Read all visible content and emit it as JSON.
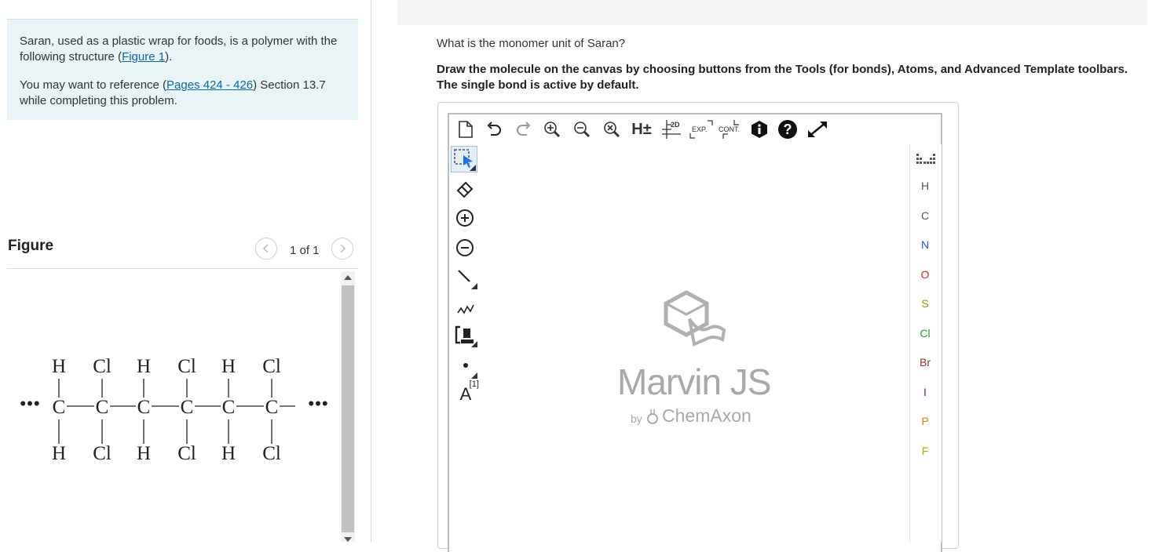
{
  "intro": {
    "p1_text": "Saran, used as a plastic wrap for foods, is a polymer with the following structure (",
    "p1_link": "Figure 1",
    "p1_end": ").",
    "p2_text": "You may want to reference (",
    "p2_link": "Pages 424 - 426",
    "p2_end": ") Section 13.7 while completing this problem."
  },
  "figure": {
    "title": "Figure",
    "count": "1 of 1",
    "structure": {
      "top_row": [
        "H",
        "Cl",
        "H",
        "Cl",
        "H",
        "Cl"
      ],
      "main_chain": [
        "C",
        "C",
        "C",
        "C",
        "C",
        "C"
      ],
      "bottom_row": [
        "H",
        "Cl",
        "H",
        "Cl",
        "H",
        "Cl"
      ],
      "left_end": "•••",
      "right_end": "•••"
    }
  },
  "question": {
    "prompt": "What is the monomer unit of Saran?",
    "instructions": "Draw the molecule on the canvas by choosing buttons from the Tools (for bonds), Atoms, and Advanced Template toolbars. The single bond is active by default."
  },
  "editor": {
    "top_tools": [
      "new-document-icon",
      "undo-icon",
      "redo-icon",
      "zoom-in-icon",
      "zoom-out-icon",
      "zoom-reset-icon",
      "add-hydrogens-icon",
      "clean-2d-icon",
      "expand-icon",
      "contract-icon",
      "info-icon",
      "help-icon",
      "fullscreen-icon"
    ],
    "hydrogen_label": "H±",
    "clean2d_label": "2D",
    "expand_label": "EXP.",
    "contract_label": "CONT.",
    "left_tools": [
      "select-icon",
      "eraser-icon",
      "plus-charge-icon",
      "minus-charge-icon",
      "single-bond-icon",
      "chain-icon",
      "bracket-icon",
      "radical-icon",
      "atom-map-icon"
    ],
    "atom_map_label": "A",
    "atom_map_sup": "[1]",
    "atoms": [
      {
        "symbol": "H",
        "color": "#555555"
      },
      {
        "symbol": "C",
        "color": "#555555"
      },
      {
        "symbol": "N",
        "color": "#3050f8"
      },
      {
        "symbol": "O",
        "color": "#e02020"
      },
      {
        "symbol": "S",
        "color": "#a09000"
      },
      {
        "symbol": "Cl",
        "color": "#1fa01f"
      },
      {
        "symbol": "Br",
        "color": "#a62929"
      },
      {
        "symbol": "I",
        "color": "#940094"
      },
      {
        "symbol": "P",
        "color": "#e08000"
      },
      {
        "symbol": "F",
        "color": "#b0a000"
      }
    ],
    "watermark_title": "Marvin JS",
    "watermark_by": "by",
    "watermark_brand": "ChemAxon"
  }
}
